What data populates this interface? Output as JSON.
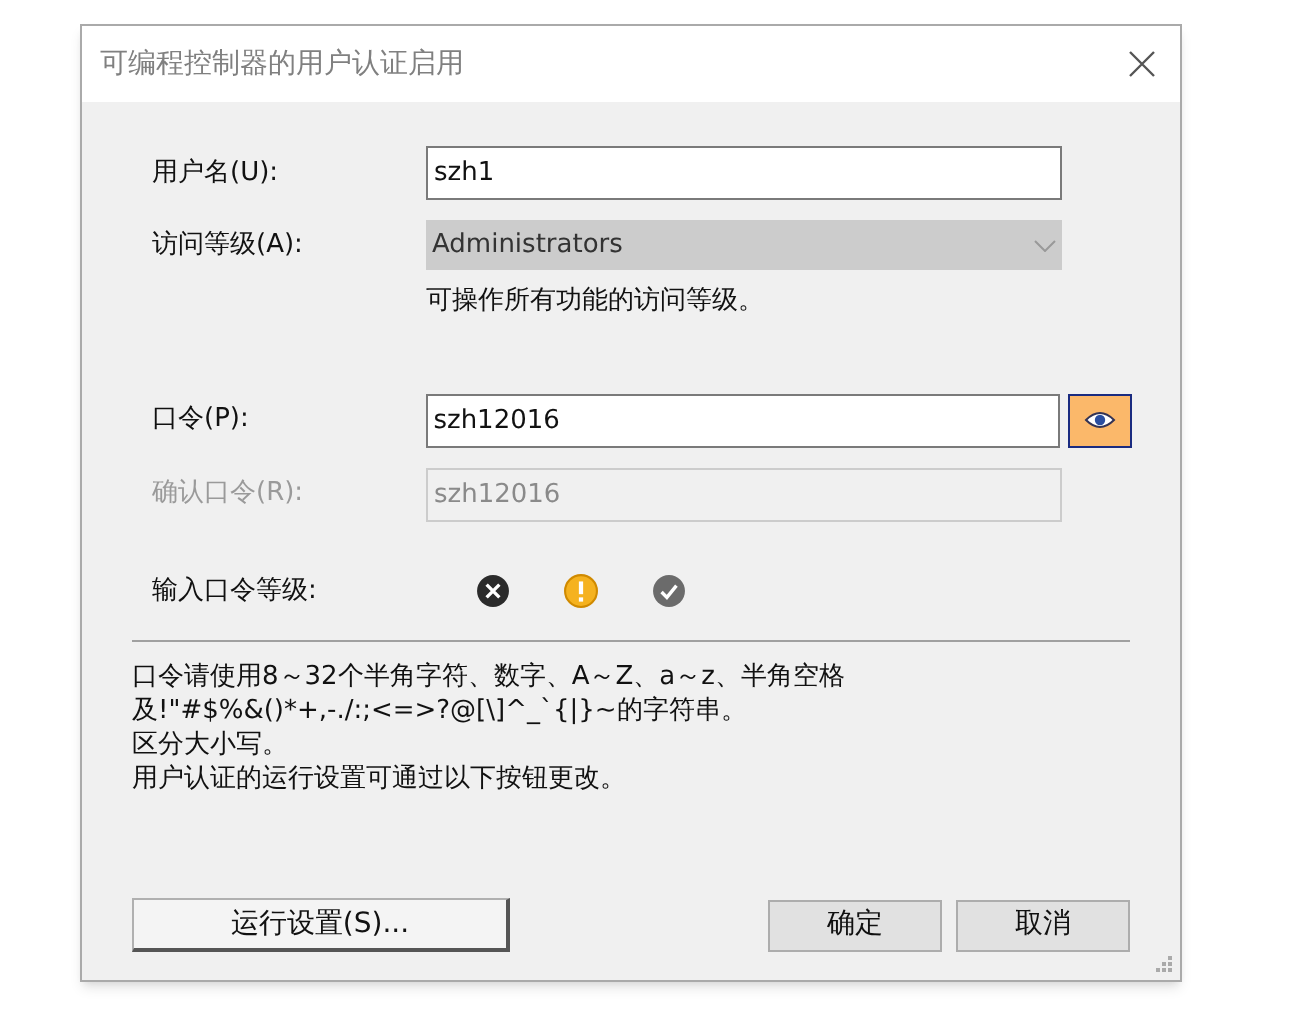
{
  "window": {
    "title": "可编程控制器的用户认证启用"
  },
  "fields": [
    {
      "kind": "text",
      "label": "用户名(U):",
      "value": "szh1",
      "disabled": false
    },
    {
      "kind": "combo",
      "label": "访问等级(A):",
      "value": "Administrators",
      "disabled": true,
      "note": "可操作所有功能的访问等级。"
    },
    {
      "kind": "password",
      "label": "口令(P):",
      "value": "szh12016",
      "disabled": false,
      "show_password": true
    },
    {
      "kind": "text",
      "label": "确认口令(R):",
      "value": "szh12016",
      "disabled": true
    }
  ],
  "strength": {
    "label": "输入口令等级:"
  },
  "notes": [
    "口令请使用8～32个半角字符、数字、A～Z、a～z、半角空格",
    "及!\"#$%&()*+,-./:;<=>?@[\\]^_`{|}~的字符串。",
    "区分大小写。",
    "用户认证的运行设置可通过以下按钮更改。"
  ],
  "buttons": [
    {
      "kind": "settings",
      "label": "运行设置(S)..."
    },
    {
      "kind": "ok",
      "label": "确定"
    },
    {
      "kind": "cancel",
      "label": "取消"
    }
  ]
}
